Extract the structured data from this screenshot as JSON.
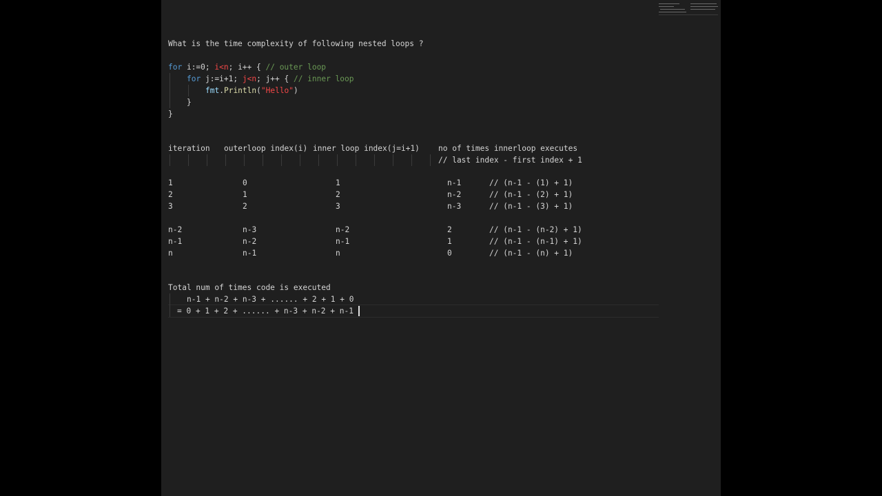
{
  "question": "What is the time complexity of following nested loops ?",
  "code": {
    "l1": {
      "kw": "for",
      "a": " i:=0; ",
      "b": "i<n",
      "c": "; i++ { ",
      "d": "// outer loop"
    },
    "l2": {
      "kw": "for",
      "a": " j:=i+1; ",
      "b": "j<n",
      "c": "; j++ { ",
      "d": "// inner loop"
    },
    "l3": {
      "obj": "fmt",
      "dot": ".",
      "fn": "Println",
      "open": "(",
      "str": "\"Hello\"",
      "close": ")"
    },
    "l4": "}",
    "l5": "}"
  },
  "table": {
    "headers": [
      "iteration",
      "outerloop index(i)",
      "inner loop index(j=i+1)",
      "no of times innerloop executes"
    ],
    "subheader": "// last index - first index + 1",
    "rows": [
      [
        "1",
        "0",
        "1",
        "n-1",
        "// (n-1 - (1) + 1)"
      ],
      [
        "2",
        "1",
        "2",
        "n-2",
        "// (n-1 - (2) + 1)"
      ],
      [
        "3",
        "2",
        "3",
        "n-3",
        "// (n-1 - (3) + 1)"
      ],
      [
        "n-2",
        "n-3",
        "n-2",
        "2",
        "// (n-1 - (n-2) + 1)"
      ],
      [
        "n-1",
        "n-2",
        "n-1",
        "1",
        "// (n-1 - (n-1) + 1)"
      ],
      [
        "n",
        "n-1",
        "n",
        "0",
        "// (n-1 - (n) + 1)"
      ]
    ]
  },
  "total": {
    "label": "Total num of times code is executed",
    "line1": "n-1 + n-2 + n-3 + ...... + 2 + 1 + 0",
    "line2": "= 0 + 1 + 2 + ...... + n-3 + n-2 + n-1"
  },
  "colors": {
    "background": "#1f1f1f",
    "text": "#d4d4d4",
    "keyword": "#569cd6",
    "variable": "#9cdcfe",
    "comment": "#6a9955",
    "string": "#ce9178"
  }
}
